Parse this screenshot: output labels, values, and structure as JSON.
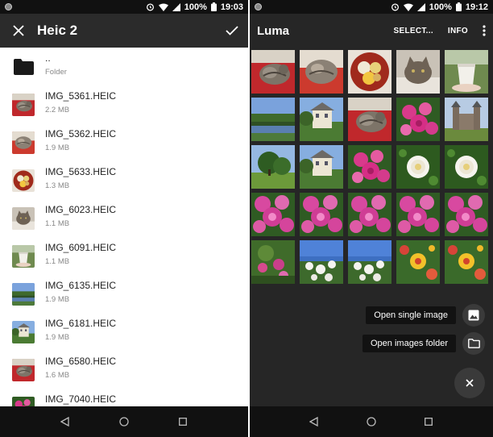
{
  "left": {
    "status": {
      "battery": "100%",
      "time": "19:03"
    },
    "appbar": {
      "title": "Heic 2"
    },
    "parent": {
      "name": "..",
      "type": "Folder"
    },
    "files": [
      {
        "name": "IMG_5361.HEIC",
        "size": "2.2 MB",
        "thumb": "cat-red"
      },
      {
        "name": "IMG_5362.HEIC",
        "size": "1.9 MB",
        "thumb": "cat-sleep"
      },
      {
        "name": "IMG_5633.HEIC",
        "size": "1.3 MB",
        "thumb": "fruit"
      },
      {
        "name": "IMG_6023.HEIC",
        "size": "1.1 MB",
        "thumb": "cat-face"
      },
      {
        "name": "IMG_6091.HEIC",
        "size": "1.1 MB",
        "thumb": "cup"
      },
      {
        "name": "IMG_6135.HEIC",
        "size": "1.9 MB",
        "thumb": "lake"
      },
      {
        "name": "IMG_6181.HEIC",
        "size": "1.9 MB",
        "thumb": "house"
      },
      {
        "name": "IMG_6580.HEIC",
        "size": "1.6 MB",
        "thumb": "cat-red"
      },
      {
        "name": "IMG_7040.HEIC",
        "size": "",
        "thumb": "pink"
      }
    ]
  },
  "right": {
    "status": {
      "battery": "100%",
      "time": "19:12"
    },
    "appbar": {
      "title": "Luma",
      "select": "SELECT...",
      "info": "INFO"
    },
    "grid": [
      "cat-red",
      "cat-sleep",
      "fruit",
      "cat-face",
      "cup",
      "lake",
      "house",
      "cat-red",
      "pink",
      "castle",
      "tree",
      "house",
      "pink",
      "white-rose",
      "white-rose",
      "peony",
      "peony",
      "peony",
      "peony",
      "peony",
      "garden",
      "blue-flowers",
      "blue-flowers",
      "yellow",
      "yellow"
    ],
    "fab": {
      "single": "Open single image",
      "folder": "Open images folder"
    }
  },
  "colors": {
    "appbar": "#2b2b2b",
    "dark_bg": "#262626",
    "fab": "#3a3a3a",
    "label_bg": "#121212"
  }
}
